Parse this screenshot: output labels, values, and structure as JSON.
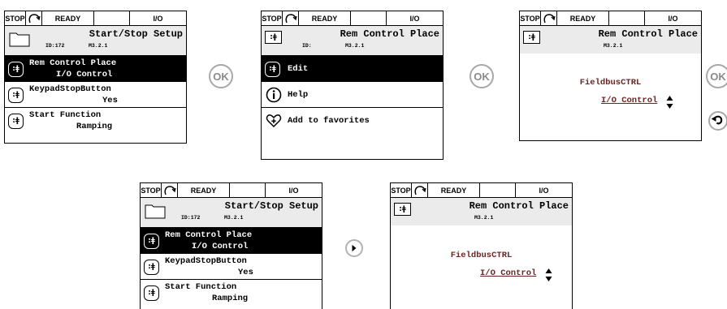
{
  "status": {
    "stop": "STOP",
    "ready": "READY",
    "io": "I/O"
  },
  "screen1": {
    "title": "Start/Stop Setup",
    "id": "ID:172",
    "code": "M3.2.1",
    "rows": [
      {
        "name": "Rem Control Place",
        "value": "I/O Control"
      },
      {
        "name": "KeypadStopButton",
        "value": "Yes"
      },
      {
        "name": "Start Function",
        "value": "Ramping"
      }
    ]
  },
  "screen2": {
    "title": "Rem Control Place",
    "id": "ID:",
    "code": "M3.2.1",
    "menu": [
      "Edit",
      "Help",
      "Add to favorites"
    ]
  },
  "screen3": {
    "title": "Rem Control Place",
    "code": "M3.2.1",
    "option_above": "FieldbusCTRL",
    "option_current": "I/O Control"
  },
  "screen4": {
    "title": "Start/Stop Setup",
    "id": "ID:172",
    "code": "M3.2.1",
    "rows": [
      {
        "name": "Rem Control Place",
        "value": "I/O Control"
      },
      {
        "name": "KeypadStopButton",
        "value": "Yes"
      },
      {
        "name": "Start Function",
        "value": "Ramping"
      }
    ]
  },
  "screen5": {
    "title": "Rem Control Place",
    "code": "M3.2.1",
    "option_above": "FieldbusCTRL",
    "option_current": "I/O Control"
  },
  "buttons": {
    "ok": "OK"
  },
  "icons": {
    "param": "param-badge-icon",
    "folder": "folder-icon",
    "info": "info-icon",
    "favorite": "heart-plus-icon",
    "back": "back-arrow-icon",
    "right": "right-arrow-icon",
    "updown": "up-down-arrows-icon",
    "rotation": "rotation-direction-icon"
  },
  "colors": {
    "value_text": "#6d2424",
    "header_bg": "#ebebeb",
    "selected_bg": "#000000"
  }
}
